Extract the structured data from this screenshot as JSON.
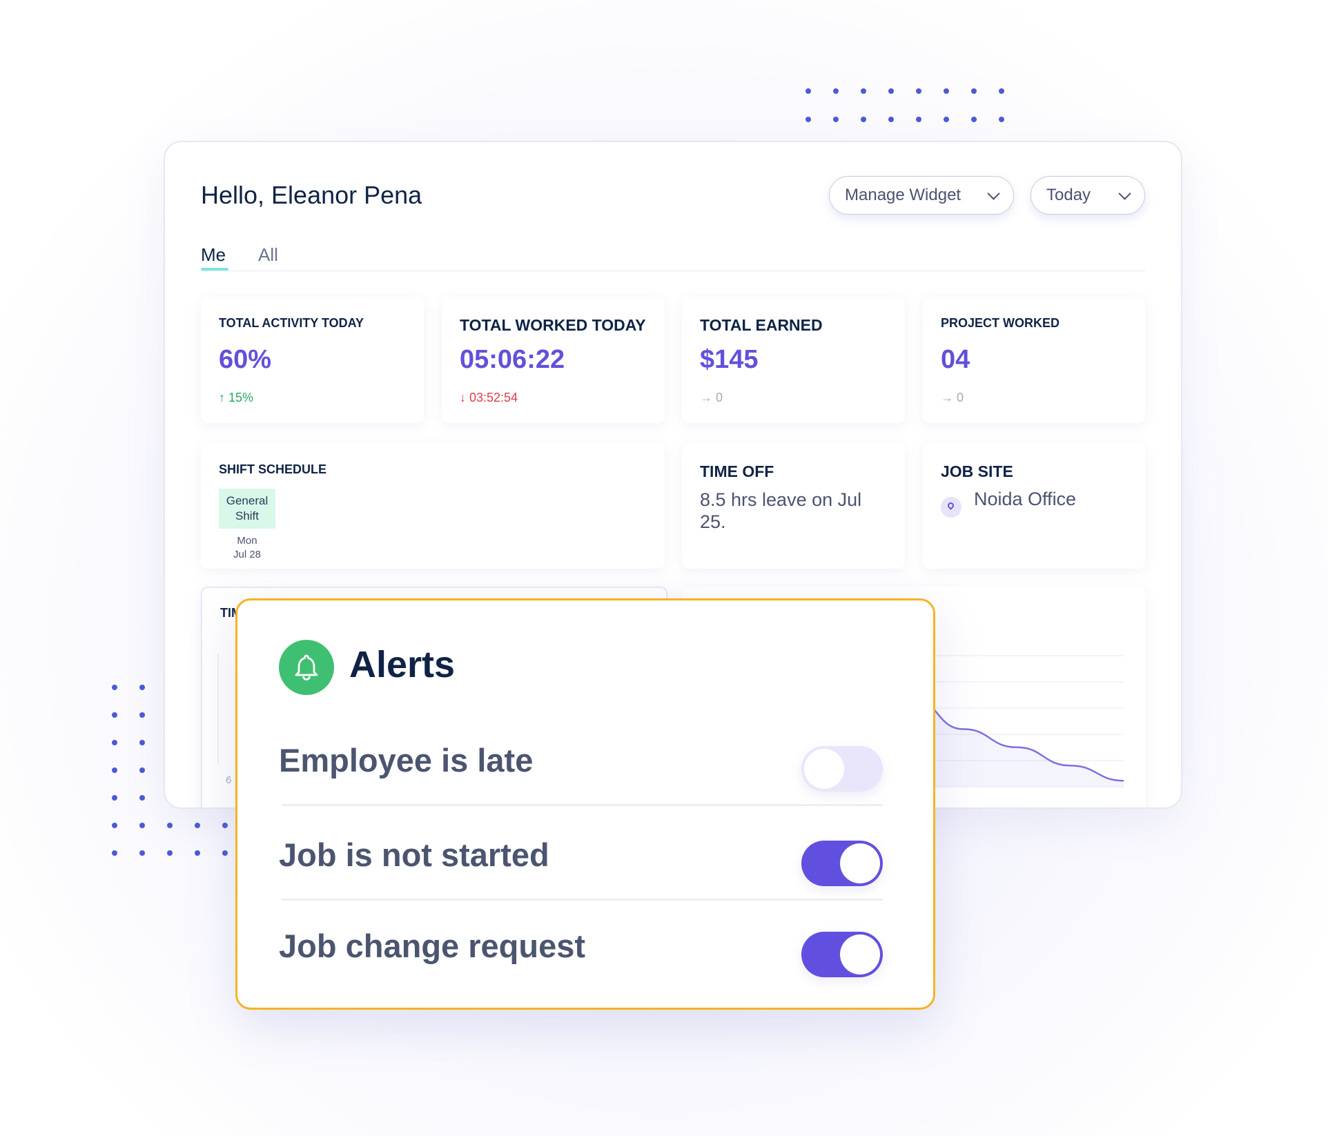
{
  "header": {
    "greeting": "Hello, Eleanor Pena",
    "manage_widget_label": "Manage Widget",
    "date_range_label": "Today"
  },
  "tabs": [
    {
      "label": "Me",
      "active": true
    },
    {
      "label": "All",
      "active": false
    }
  ],
  "stats": [
    {
      "label": "TOTAL ACTIVITY TODAY",
      "value": "60%",
      "delta_icon": "↑",
      "delta": "15%",
      "trend": "up"
    },
    {
      "label": "TOTAL WORKED TODAY",
      "value": "05:06:22",
      "delta_icon": "↓",
      "delta": "03:52:54",
      "trend": "down"
    },
    {
      "label": "TOTAL EARNED",
      "value": "$145",
      "delta_icon": "→",
      "delta": "0",
      "trend": "flat"
    },
    {
      "label": "PROJECT WORKED",
      "value": "04",
      "delta_icon": "→",
      "delta": "0",
      "trend": "flat"
    }
  ],
  "shift_schedule": {
    "label": "SHIFT SCHEDULE",
    "shift_name": "General Shift",
    "day": "Mon",
    "date": "Jul 28"
  },
  "time_off": {
    "label": "TIME OFF",
    "text": "8.5 hrs leave on Jul 25."
  },
  "job_site": {
    "label": "JOB SITE",
    "location": "Noida Office"
  },
  "partial_widget": {
    "label_fragment": "TIM",
    "axis_tick_fragment": "6"
  },
  "trend_chart": {
    "values": [
      100,
      98,
      94,
      80,
      60,
      38,
      26,
      14,
      4
    ]
  },
  "alerts": {
    "title": "Alerts",
    "items": [
      {
        "label": "Employee is late",
        "enabled": false
      },
      {
        "label": "Job is not started",
        "enabled": true
      },
      {
        "label": "Job change request",
        "enabled": true
      }
    ]
  },
  "colors": {
    "accent": "#6250db",
    "alert_border": "#f6b323",
    "bell_green": "#3fbf71",
    "up": "#27a960",
    "down": "#e03a4a",
    "tab_underline": "#7de3e0",
    "dots": "#4a5bd6"
  }
}
